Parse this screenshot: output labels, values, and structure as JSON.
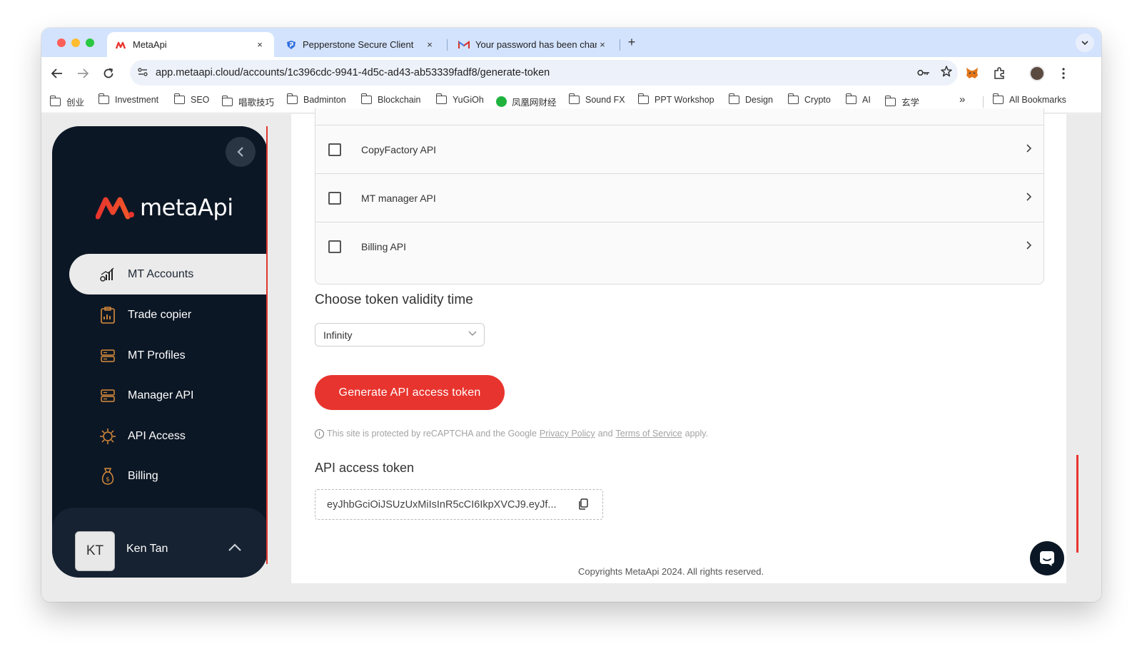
{
  "browser": {
    "tabs": [
      {
        "label": "MetaApi",
        "active": true
      },
      {
        "label": "Pepperstone Secure Client",
        "active": false
      },
      {
        "label": "Your password has been char",
        "active": false
      }
    ],
    "close_glyph": "×",
    "new_tab_glyph": "+",
    "url": "app.metaapi.cloud/accounts/1c396cdc-9941-4d5c-ad43-ab53339fadf8/generate-token",
    "bookmarks": [
      "创业",
      "Investment",
      "SEO",
      "唱歌技巧",
      "Badminton",
      "Blockchain",
      "YuGiOh",
      "凤凰网财经",
      "Sound FX",
      "PPT Workshop",
      "Design",
      "Crypto",
      "AI",
      "玄学"
    ],
    "bookmarks_overflow": "»",
    "all_bookmarks": "All Bookmarks"
  },
  "sidebar": {
    "brand": "metaApi",
    "nav": [
      {
        "label": "MT Accounts",
        "icon": "chart-candles-icon",
        "active": true
      },
      {
        "label": "Trade copier",
        "icon": "clipboard-icon",
        "active": false
      },
      {
        "label": "MT Profiles",
        "icon": "server-icon",
        "active": false
      },
      {
        "label": "Manager API",
        "icon": "server-icon",
        "active": false
      },
      {
        "label": "API Access",
        "icon": "api-gear-icon",
        "active": false
      },
      {
        "label": "Billing",
        "icon": "money-bag-icon",
        "active": false
      }
    ],
    "user": {
      "initials": "KT",
      "name": "Ken Tan"
    }
  },
  "main": {
    "apis": [
      {
        "label": "CopyFactory API",
        "checked": false
      },
      {
        "label": "MT manager API",
        "checked": false
      },
      {
        "label": "Billing API",
        "checked": false
      }
    ],
    "validity_title": "Choose token validity time",
    "validity_value": "Infinity",
    "generate_button": "Generate API access token",
    "recaptcha": {
      "prefix": "This site is protected by reCAPTCHA and the Google",
      "privacy": "Privacy Policy",
      "and": "and",
      "terms": "Terms of Service",
      "suffix": "apply."
    },
    "token_title": "API access token",
    "token_value": "eyJhbGciOiJSUzUxMiIsInR5cCI6IkpXVCJ9.eyJf..."
  },
  "footer": "Copyrights MetaApi 2024. All rights reserved.",
  "colors": {
    "accent": "#e8342e",
    "sidebar": "#0c1725",
    "tab_strip": "#d3e3fd"
  }
}
